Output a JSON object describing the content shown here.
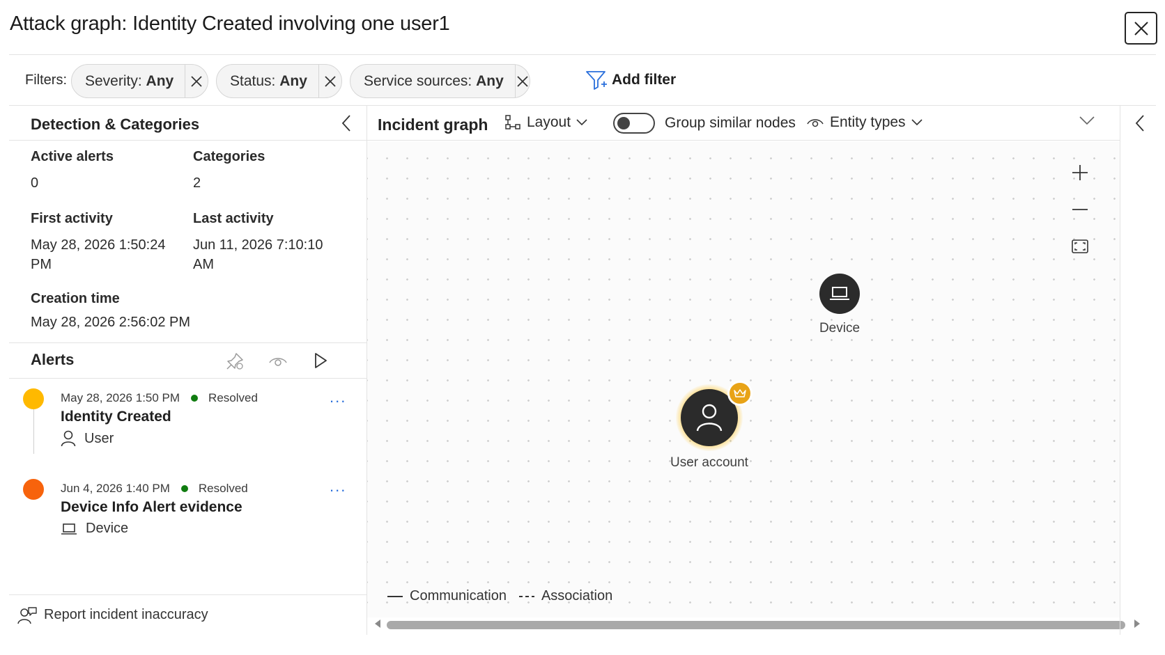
{
  "header": {
    "title": "Attack graph: Identity Created involving one user1"
  },
  "filters": {
    "label": "Filters:",
    "chips": [
      {
        "key": "Severity:",
        "value": "Any"
      },
      {
        "key": "Status:",
        "value": "Any"
      },
      {
        "key": "Service sources:",
        "value": "Any"
      }
    ],
    "add_filter": "Add filter"
  },
  "detection": {
    "title": "Detection & Categories",
    "active_alerts_label": "Active alerts",
    "active_alerts_value": "0",
    "categories_label": "Categories",
    "categories_value": "2",
    "first_activity_label": "First activity",
    "first_activity_value_line1": "May 28, 2026 1:50:24",
    "first_activity_value_line2": "PM",
    "last_activity_label": "Last activity",
    "last_activity_value_line1": "Jun 11, 2026 7:10:10",
    "last_activity_value_line2": "AM",
    "creation_time_label": "Creation time",
    "creation_time_value": "May 28, 2026 2:56:02 PM"
  },
  "alerts": {
    "title": "Alerts",
    "items": [
      {
        "timestamp": "May 28, 2026 1:50 PM",
        "status": "Resolved",
        "title": "Identity Created",
        "entity": "User",
        "severity_color": "#FFB900"
      },
      {
        "timestamp": "Jun 4, 2026 1:40 PM",
        "status": "Resolved",
        "title": "Device Info Alert evidence",
        "entity": "Device",
        "severity_color": "#F7630C"
      }
    ],
    "more_label": "..."
  },
  "report": {
    "label": "Report incident inaccuracy"
  },
  "graph": {
    "title": "Incident graph",
    "layout_label": "Layout",
    "group_similar_label": "Group similar nodes",
    "group_similar_on": false,
    "entity_types_label": "Entity types",
    "nodes": [
      {
        "label": "Device",
        "icon": "laptop-icon"
      },
      {
        "label": "User account",
        "icon": "user-icon",
        "badge": "crown-icon"
      }
    ],
    "legend": {
      "communication": "Communication",
      "association": "Association"
    }
  },
  "colors": {
    "accent": "#2A6FDB",
    "resolved": "#107C10",
    "node_fill": "#2B2B2B",
    "badge": "#E8A317"
  }
}
